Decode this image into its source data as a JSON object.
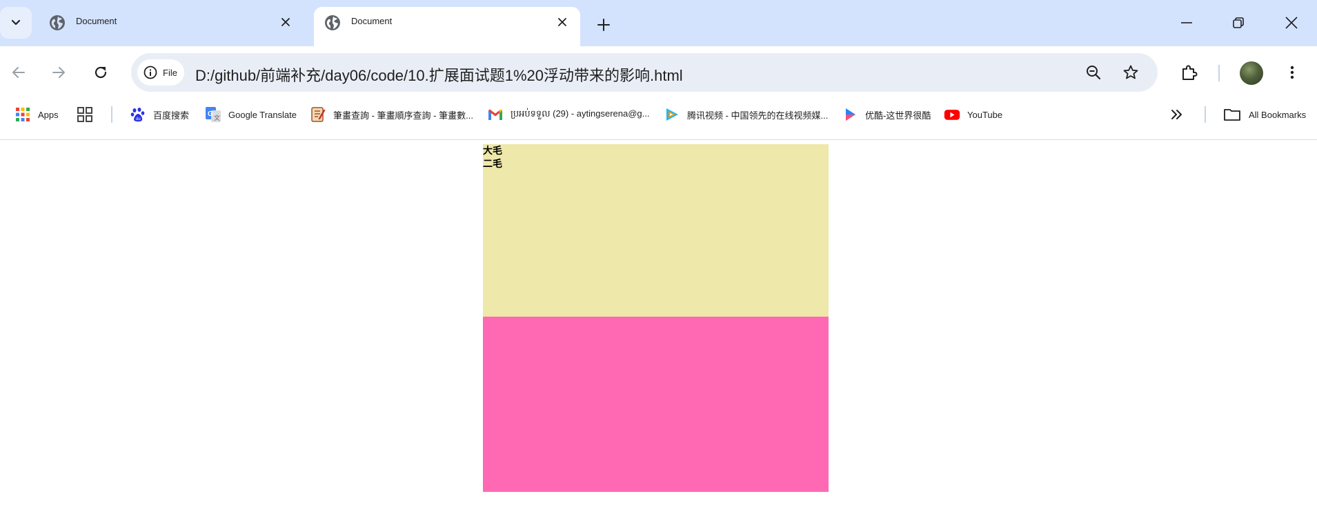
{
  "tabs": [
    {
      "title": "Document"
    },
    {
      "title": "Document"
    }
  ],
  "address": {
    "chip_label": "File",
    "url": "D:/github/前端补充/day06/code/10.扩展面试题1%20浮动带来的影响.html"
  },
  "bookmarks": {
    "items": [
      {
        "label": "Apps"
      },
      {
        "label": "百度搜索"
      },
      {
        "label": "Google Translate"
      },
      {
        "label": "筆畫查詢 - 筆畫順序查詢 - 筆畫數..."
      },
      {
        "label": "ប្រអប់ទទួល (29) - aytingserena@g..."
      },
      {
        "label": "腾讯视频 - 中国领先的在线视频媒..."
      },
      {
        "label": "优酷-这世界很酷"
      },
      {
        "label": "YouTube"
      }
    ],
    "all_label": "All Bookmarks"
  },
  "page": {
    "float_items": [
      "大毛",
      "二毛"
    ],
    "box1_color": "#eee8aa",
    "box2_color": "#ff69b4"
  },
  "colors": {
    "tabstrip": "#d3e3fd",
    "omnibox": "#e9eef6"
  }
}
